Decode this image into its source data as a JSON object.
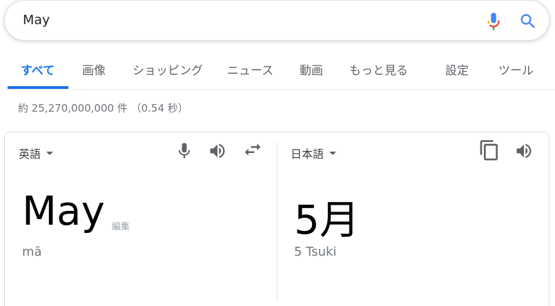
{
  "search": {
    "query": "May",
    "mic_icon": "microphone-icon",
    "search_icon": "search-icon"
  },
  "tabs": [
    {
      "label": "すべて",
      "active": true
    },
    {
      "label": "画像"
    },
    {
      "label": "ショッピング"
    },
    {
      "label": "ニュース"
    },
    {
      "label": "動画"
    },
    {
      "label": "もっと見る"
    },
    {
      "label": "設定"
    },
    {
      "label": "ツール"
    }
  ],
  "result_stats": "約 25,270,000,000 件 （0.54 秒）",
  "translate": {
    "source": {
      "language": "英語",
      "text": "May",
      "edit_label": "編集",
      "pronunciation": "mā"
    },
    "target": {
      "language": "日本語",
      "text": "5月",
      "pronunciation": "5 Tsuki"
    }
  },
  "colors": {
    "accent": "#1a73e8",
    "icon_gray": "#5f6368"
  }
}
